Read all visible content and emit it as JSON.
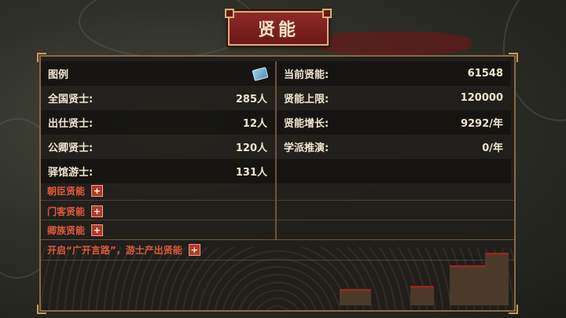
{
  "title": "贤能",
  "left_panel": {
    "legend_label": "图例",
    "legend_icon": "scroll-icon",
    "rows": [
      {
        "label": "全国贤士:",
        "value": "285人"
      },
      {
        "label": "出仕贤士:",
        "value": "12人"
      },
      {
        "label": "公卿贤士:",
        "value": "120人"
      },
      {
        "label": "驿馆游士:",
        "value": "131人"
      }
    ]
  },
  "right_panel": {
    "rows": [
      {
        "label": "当前贤能:",
        "value": "61548"
      },
      {
        "label": "贤能上限:",
        "value": "120000"
      },
      {
        "label": "贤能增长:",
        "value": "9292/年"
      },
      {
        "label": "学派推演:",
        "value": "0/年"
      }
    ]
  },
  "bonuses": [
    {
      "label": "朝臣贤能"
    },
    {
      "label": "门客贤能"
    },
    {
      "label": "卿族贤能"
    },
    {
      "label": "开启“广开言路”，游士产出贤能"
    }
  ],
  "colors": {
    "title_bg": "#8e2a26",
    "border": "#8a6a45",
    "bonus_text": "#e25a3a",
    "text": "#f1e6cf"
  }
}
